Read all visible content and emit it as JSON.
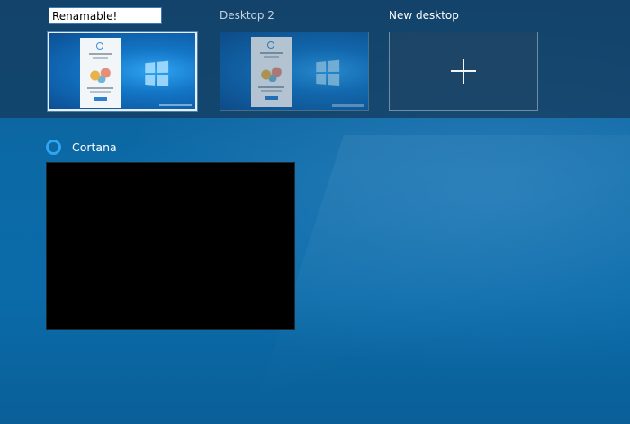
{
  "task_view": {
    "desktops": [
      {
        "name": "Renamable!",
        "editing": true,
        "selected": true
      },
      {
        "name": "Desktop 2",
        "editing": false,
        "selected": false
      }
    ],
    "new_desktop": {
      "label": "New desktop",
      "icon": "plus-icon"
    }
  },
  "windows": [
    {
      "title": "Cortana",
      "icon": "cortana-ring-icon",
      "preview": "black"
    }
  ],
  "colors": {
    "desktop_bg": "#0b6aa6",
    "strip_bg": "#143c5f",
    "cortana_ring": "#2ea6f2",
    "selected_border": "#e8eef4"
  }
}
